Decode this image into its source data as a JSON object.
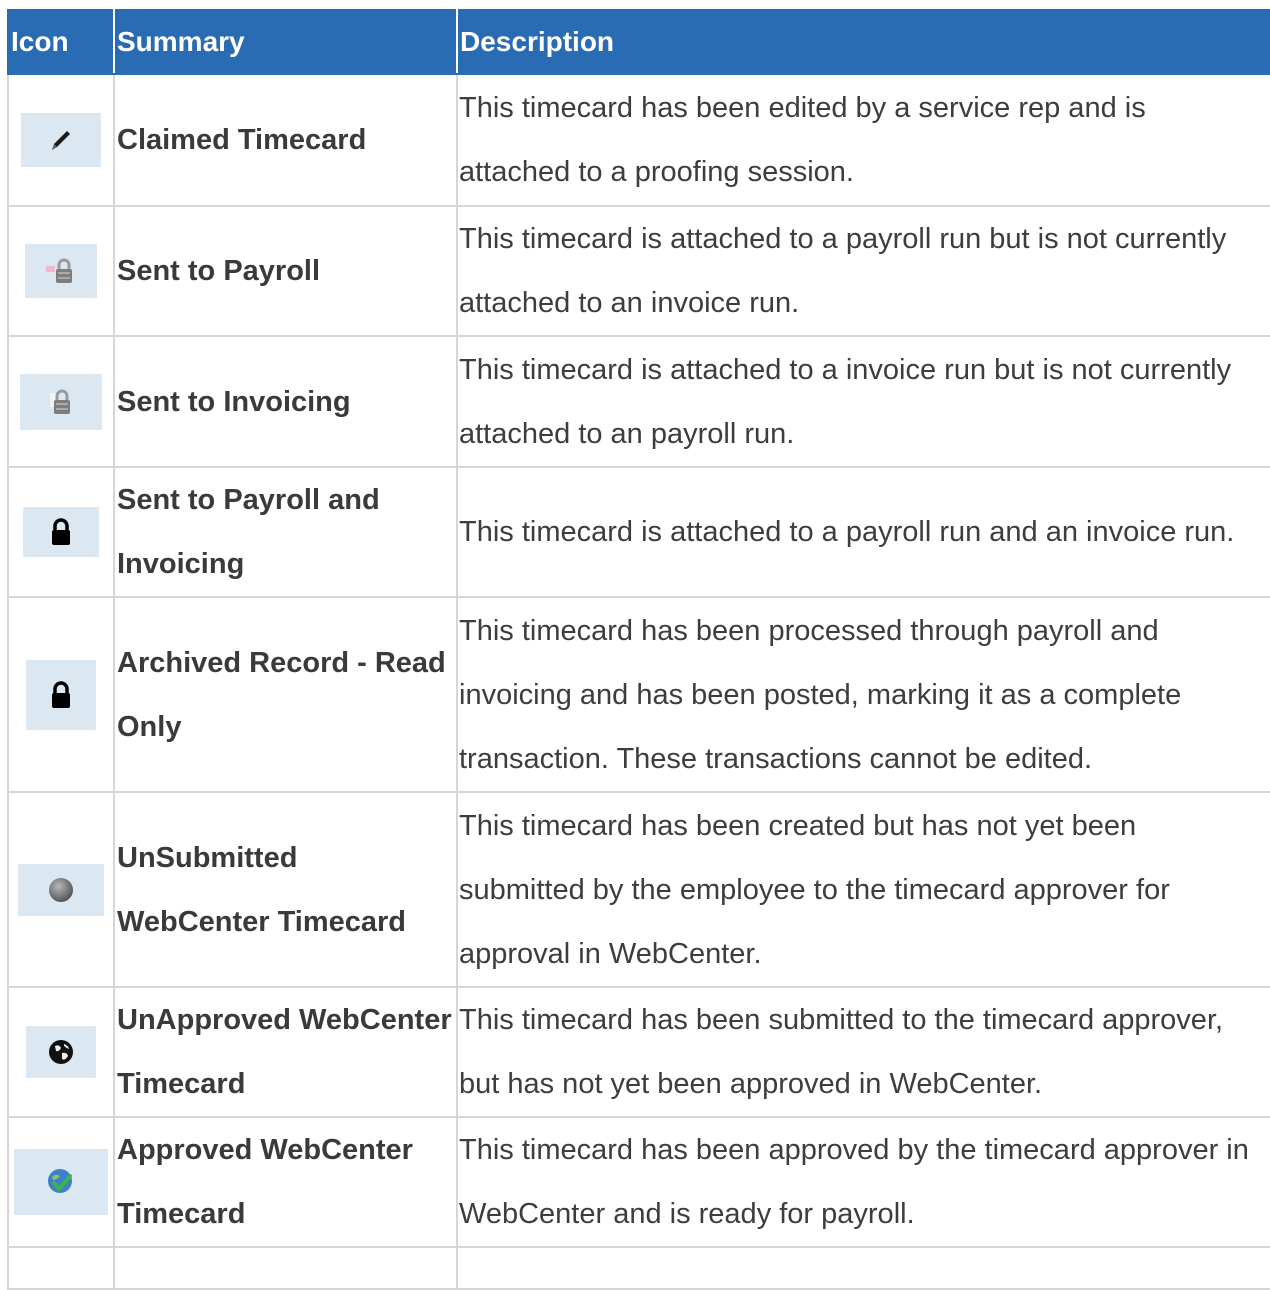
{
  "table": {
    "headers": [
      "Icon",
      "Summary",
      "Description"
    ],
    "rows": [
      {
        "icon": "pencil-icon",
        "summary": "Claimed Timecard",
        "description": " This timecard has been edited by a service rep and is attached to a proofing session."
      },
      {
        "icon": "payroll-lock-icon",
        "summary": "Sent to Payroll",
        "description": " This timecard is attached to a payroll run but is not currently attached to an invoice run."
      },
      {
        "icon": "invoice-lock-icon",
        "summary": "Sent to Invoicing",
        "description": "This timecard is attached to a invoice run but is not currently attached to an payroll run."
      },
      {
        "icon": "lock-icon",
        "summary": "Sent to Payroll and Invoicing",
        "description": "This timecard is attached to a payroll run and an invoice run."
      },
      {
        "icon": "archived-lock-icon",
        "summary": "Archived Record - Read Only",
        "description": " This timecard has been processed through payroll and invoicing and has been posted, marking it as a complete transaction. These transactions cannot be edited."
      },
      {
        "icon": "grey-globe-icon",
        "summary": "UnSubmitted WebCenter Timecard",
        "description": " This timecard has been created but has not yet been submitted by the employee to the timecard approver for approval in WebCenter."
      },
      {
        "icon": "black-globe-icon",
        "summary": "UnApproved WebCenter Timecard",
        "description": " This timecard has been submitted to the timecard approver, but has not yet been approved in WebCenter."
      },
      {
        "icon": "approved-globe-icon",
        "summary": "Approved WebCenter Timecard",
        "description": " This timecard has been approved by the timecard approver in WebCenter and is ready for payroll."
      }
    ]
  },
  "colors": {
    "header_bg": "#2a6cb3",
    "header_text": "#ffffff",
    "border": "#d6d6d6",
    "icon_bg": "#dbe8f2"
  }
}
